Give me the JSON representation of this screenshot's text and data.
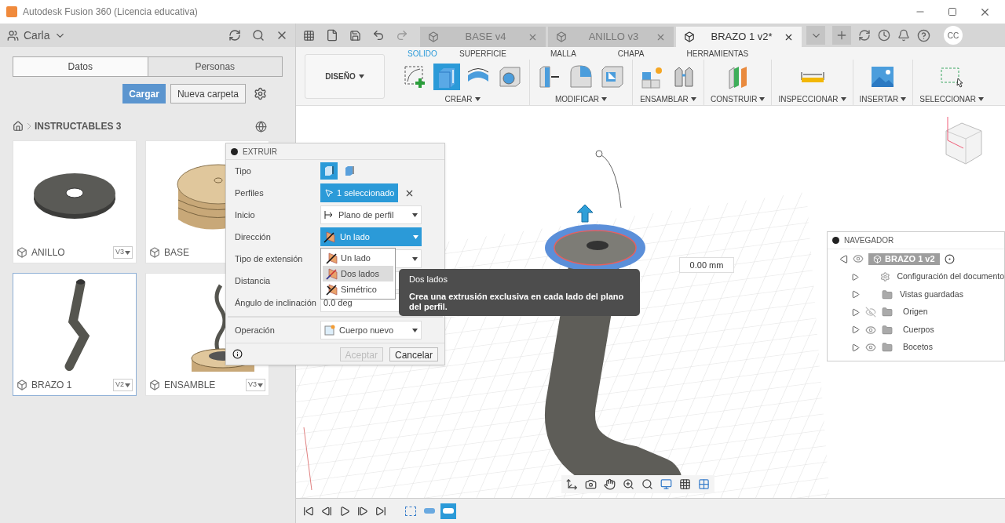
{
  "window": {
    "title": "Autodesk Fusion 360 (Licencia educativa)"
  },
  "data_panel": {
    "user": "Carla",
    "tabs": [
      {
        "label": "Datos",
        "selected": true
      },
      {
        "label": "Personas",
        "selected": false
      }
    ],
    "buttons": [
      {
        "label": "Cargar",
        "kind": "primary"
      },
      {
        "label": "Nueva carpeta",
        "kind": "secondary"
      }
    ],
    "breadcrumb": "INSTRUCTABLES 3",
    "files": [
      {
        "name": "ANILLO",
        "version": "V3",
        "kind": "ring",
        "selected": false
      },
      {
        "name": "BASE",
        "kind": "base",
        "selected": false
      },
      {
        "name": "BRAZO 1",
        "version": "V2",
        "kind": "arm",
        "selected": true
      },
      {
        "name": "ENSAMBLE",
        "version": "V3",
        "kind": "assembly",
        "selected": false
      }
    ]
  },
  "document_tabs": [
    {
      "label": "BASE v4",
      "selected": false
    },
    {
      "label": "ANILLO v3",
      "selected": false
    },
    {
      "label": "BRAZO 1 v2*",
      "selected": true
    }
  ],
  "user_initials": "CC",
  "workspace": "DISEÑO",
  "ribbon_tabs": [
    {
      "label": "SOLIDO",
      "selected": true
    },
    {
      "label": "SUPERFICIE",
      "selected": false
    },
    {
      "label": "MALLA",
      "selected": false
    },
    {
      "label": "CHAPA",
      "selected": false
    },
    {
      "label": "HERRAMIENTAS",
      "selected": false
    }
  ],
  "ribbon_groups": [
    {
      "label": "CREAR",
      "tools": [
        {
          "kind": "sketch",
          "selected": false
        },
        {
          "kind": "extrude",
          "selected": true
        },
        {
          "kind": "revolve",
          "selected": false
        },
        {
          "kind": "hole",
          "selected": false
        }
      ]
    },
    {
      "label": "MODIFICAR",
      "tools": [
        {
          "kind": "presspull",
          "selected": false
        },
        {
          "kind": "fillet",
          "selected": false
        },
        {
          "kind": "shell",
          "selected": false
        }
      ]
    },
    {
      "label": "ENSAMBLAR",
      "tools": [
        {
          "kind": "newcomp",
          "selected": false
        },
        {
          "kind": "joint",
          "selected": false
        }
      ]
    },
    {
      "label": "CONSTRUIR",
      "tools": [
        {
          "kind": "plane",
          "selected": false
        }
      ]
    },
    {
      "label": "INSPECCIONAR",
      "tools": [
        {
          "kind": "measure",
          "selected": false
        }
      ]
    },
    {
      "label": "INSERTAR",
      "tools": [
        {
          "kind": "image",
          "selected": false
        }
      ]
    },
    {
      "label": "SELECCIONAR",
      "tools": [
        {
          "kind": "select",
          "selected": false
        }
      ]
    }
  ],
  "dialog": {
    "title": "EXTRUIR",
    "type_label": "Tipo",
    "types": [
      {
        "selected": true
      },
      {
        "selected": false
      }
    ],
    "profiles": {
      "label": "Perfiles",
      "value": "1 seleccionado"
    },
    "start": {
      "label": "Inicio",
      "value": "Plano de perfil"
    },
    "direction": {
      "label": "Dirección",
      "value": "Un lado",
      "expanded": true,
      "options": [
        {
          "label": "Un lado",
          "kind": "one",
          "highlighted": false
        },
        {
          "label": "Dos lados",
          "kind": "two",
          "highlighted": true
        },
        {
          "label": "Simétrico",
          "kind": "sym",
          "highlighted": false
        }
      ]
    },
    "extent_label": "Tipo de extensión",
    "distance_label": "Distancia",
    "angle": {
      "label": "Ángulo de inclinación",
      "value": "0.0 deg"
    },
    "operation": {
      "label": "Operación",
      "value": "Cuerpo nuevo"
    },
    "buttons": [
      {
        "label": "Aceptar",
        "disabled": true
      },
      {
        "label": "Cancelar",
        "disabled": false
      }
    ]
  },
  "tooltip": {
    "title": "Dos lados",
    "text": "Crea una extrusión exclusiva en cada lado del plano del perfil."
  },
  "distance_field": "0.00 mm",
  "navigator": {
    "title": "NAVEGADOR",
    "root": "BRAZO 1 v2",
    "items": [
      {
        "label": "Configuración del documento",
        "kind": "settings"
      },
      {
        "label": "Vistas guardadas",
        "kind": "folder"
      },
      {
        "label": "Origen",
        "kind": "folder",
        "visible": false
      },
      {
        "label": "Cuerpos",
        "kind": "folder",
        "visible": true
      },
      {
        "label": "Bocetos",
        "kind": "folder",
        "visible": true
      }
    ]
  },
  "timeline": [
    {
      "kind": "sketch",
      "selected": false
    },
    {
      "kind": "extrude",
      "selected": false
    },
    {
      "kind": "extrude",
      "selected": true
    }
  ]
}
